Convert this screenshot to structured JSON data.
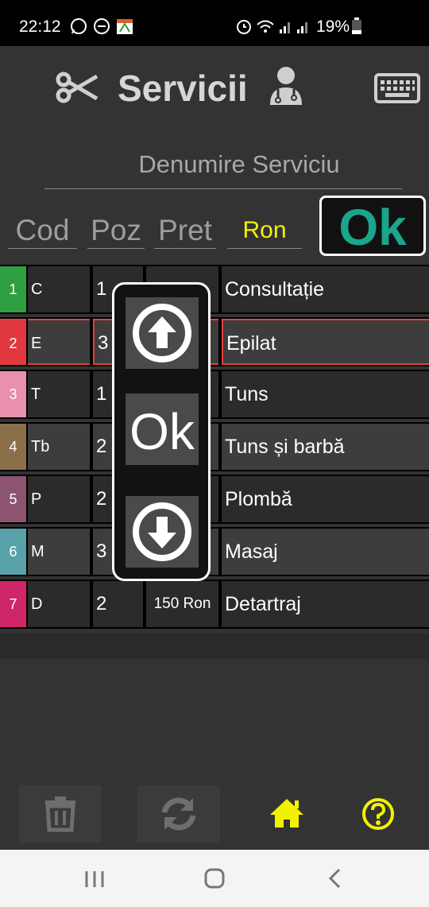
{
  "status_bar": {
    "time": "22:12",
    "battery": "19%"
  },
  "header": {
    "title": "Servicii"
  },
  "form": {
    "name_placeholder": "Denumire Serviciu",
    "cod_placeholder": "Cod",
    "poz_placeholder": "Poz",
    "pret_placeholder": "Pret",
    "currency": "Ron",
    "ok_label": "Ok"
  },
  "rows": [
    {
      "num": "1",
      "cod": "C",
      "poz": "1",
      "pret": "",
      "den": "Consultație",
      "color": "#2ea043"
    },
    {
      "num": "2",
      "cod": "E",
      "poz": "3",
      "pret": "",
      "den": "Epilat",
      "color": "#e0383e"
    },
    {
      "num": "3",
      "cod": "T",
      "poz": "1",
      "pret": "",
      "den": "Tuns",
      "color": "#e98fb0"
    },
    {
      "num": "4",
      "cod": "Tb",
      "poz": "2",
      "pret": "",
      "den": "Tuns și barbă",
      "color": "#8a6f4b"
    },
    {
      "num": "5",
      "cod": "P",
      "poz": "2",
      "pret": "",
      "den": "Plombă",
      "color": "#8c546f"
    },
    {
      "num": "6",
      "cod": "M",
      "poz": "3",
      "pret": "",
      "den": "Masaj",
      "color": "#5aa2a9"
    },
    {
      "num": "7",
      "cod": "D",
      "poz": "2",
      "pret": "150 Ron",
      "den": "Detartraj",
      "color": "#d1256a"
    }
  ],
  "popup": {
    "ok_label": "Ok"
  },
  "colors": {
    "accent_yellow": "#f2f200",
    "ok_green": "#1aa58c",
    "selected_border": "#e24040"
  },
  "icons": [
    "scissors-icon",
    "doctor-icon",
    "keyboard-icon",
    "arrow-up-icon",
    "arrow-down-icon",
    "trash-icon",
    "refresh-icon",
    "home-icon",
    "help-icon"
  ]
}
